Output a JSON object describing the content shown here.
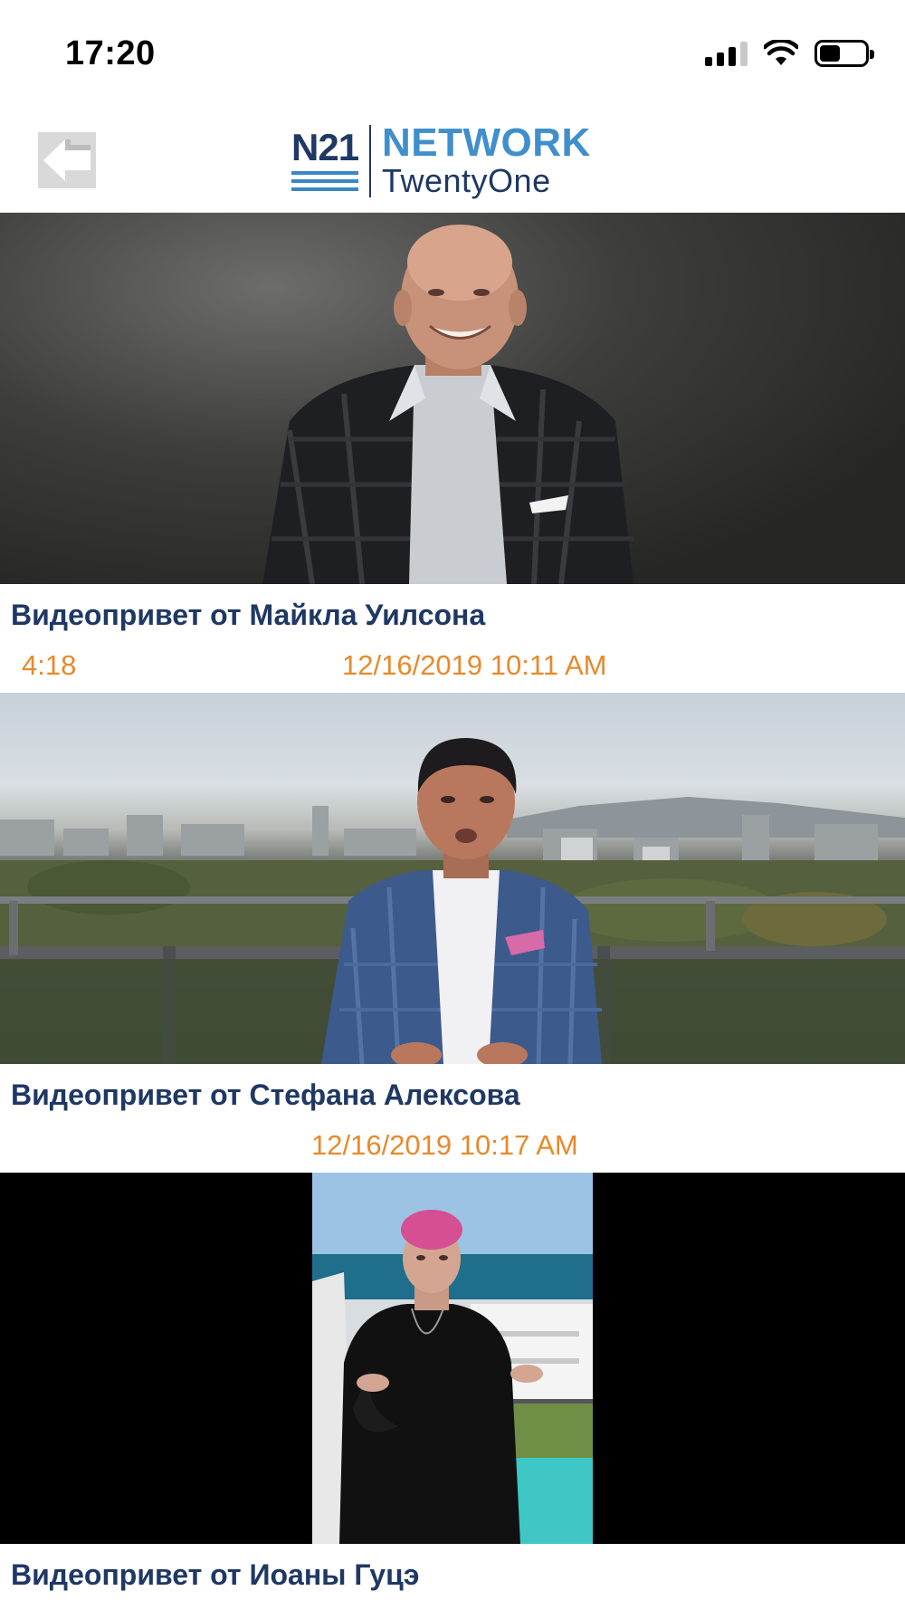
{
  "status_bar": {
    "time": "17:20",
    "icons": [
      "cellular-signal-icon",
      "wifi-icon",
      "battery-icon"
    ]
  },
  "header": {
    "back_icon": "back-arrow-icon",
    "logo": {
      "mark": "N21",
      "line1": "NETWORK",
      "line2": "TwentyOne"
    }
  },
  "videos": [
    {
      "title": "Видеопривет от Майкла Уилсона",
      "duration": "4:18",
      "date": "12/16/2019 10:11 AM"
    },
    {
      "title": "Видеопривет от Стефана Алексова",
      "duration": "",
      "date": "12/16/2019 10:17 AM"
    },
    {
      "title": "Видеопривет от Иоаны Гуцэ"
    }
  ],
  "colors": {
    "title": "#1f3864",
    "meta": "#e8892b",
    "logo_accent": "#3f8fcc"
  }
}
